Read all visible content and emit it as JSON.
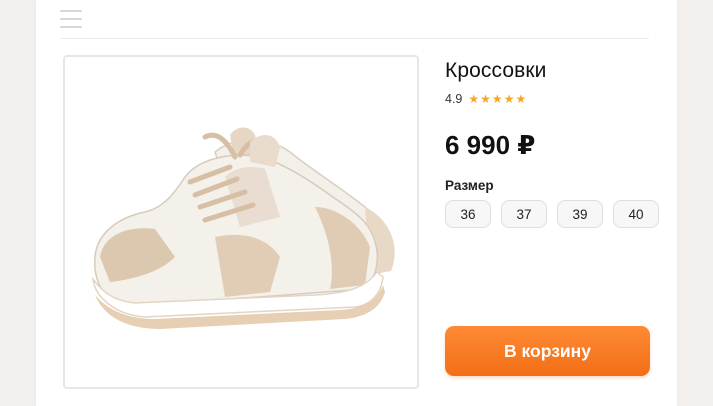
{
  "header": {
    "menu_icon": "hamburger-menu-icon"
  },
  "product": {
    "title": "Кроссовки",
    "rating": "4.9",
    "stars_count": 5,
    "price": "6 990 ₽",
    "image_icon": "sneakers-image"
  },
  "sizes": {
    "label": "Размер",
    "options": [
      "36",
      "37",
      "39",
      "40"
    ]
  },
  "cart": {
    "button_label": "В корзину"
  },
  "colors": {
    "accent": "#f26e16",
    "star": "#f7a823",
    "background": "#f2efec"
  }
}
